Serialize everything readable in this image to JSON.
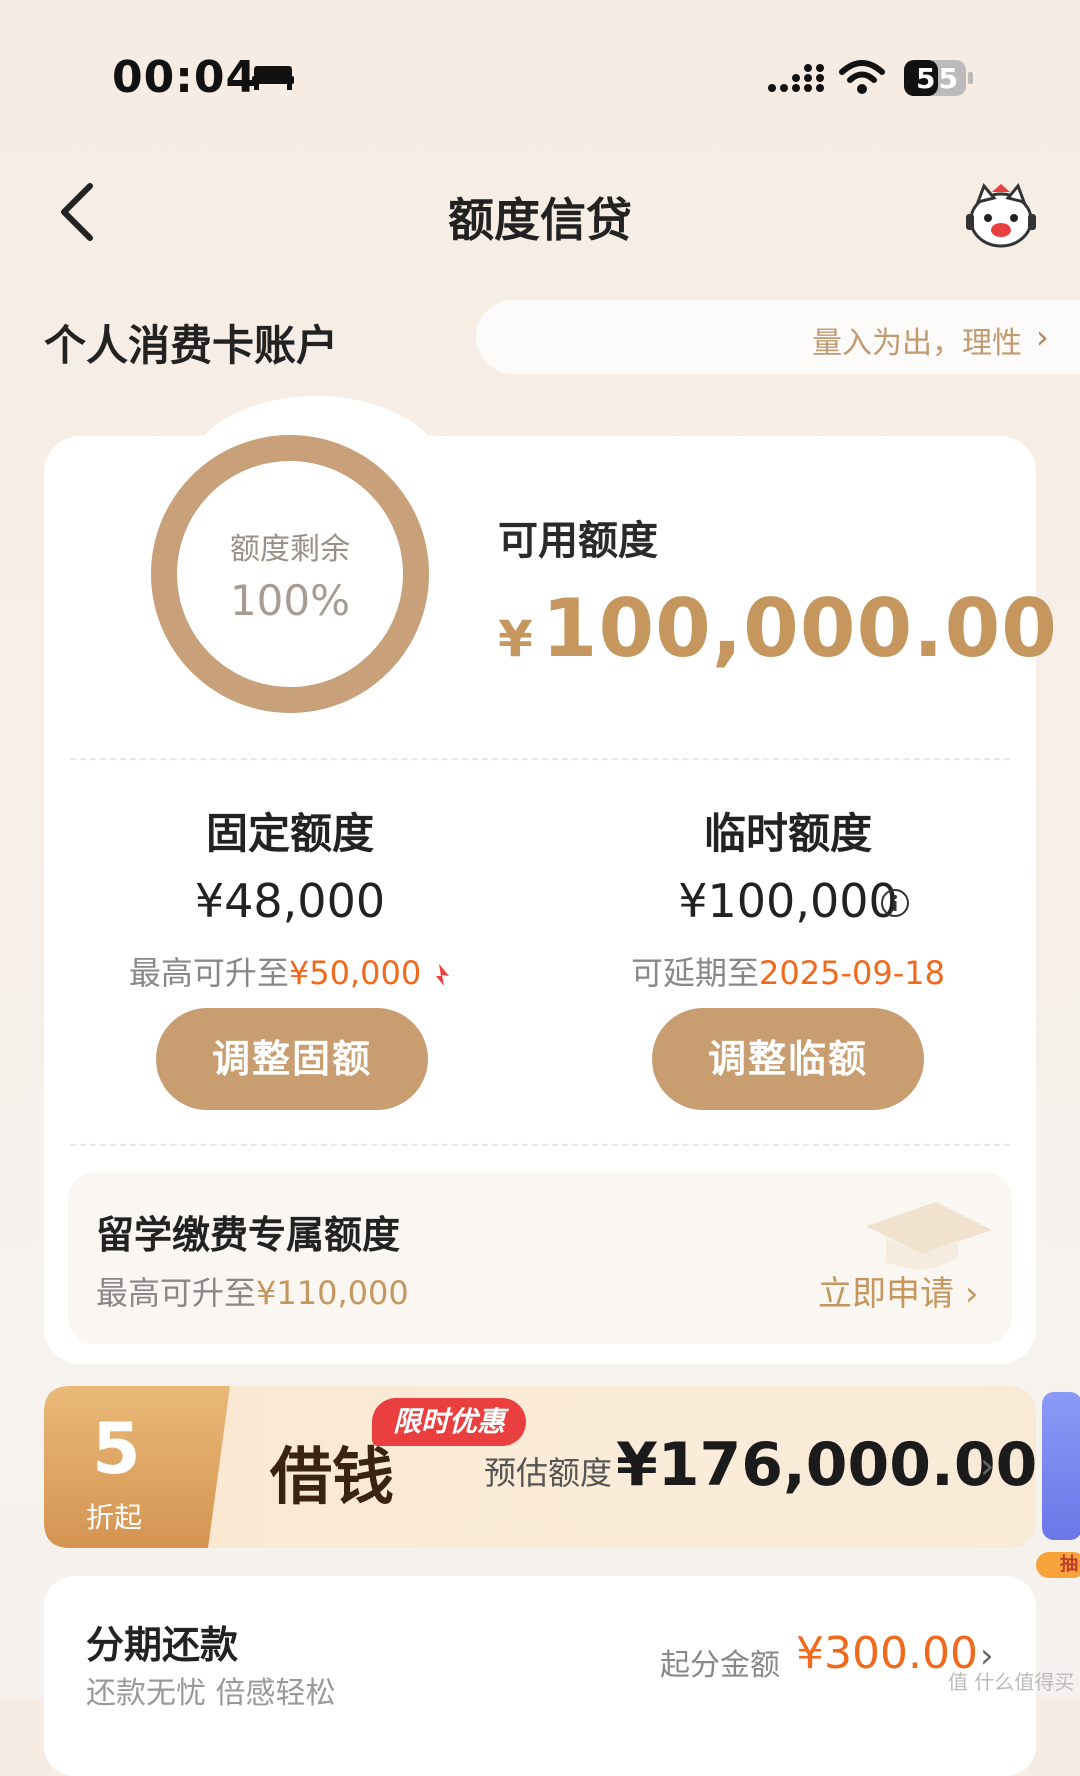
{
  "status_bar": {
    "time": "00:04",
    "battery": "55"
  },
  "nav": {
    "title": "额度信贷"
  },
  "account": {
    "title": "个人消费卡账户",
    "slogan": "量入为出，理性"
  },
  "quota": {
    "ring_label": "额度剩余",
    "ring_value": "100%",
    "ring_fraction": 1.0,
    "available_label": "可用额度",
    "available_currency": "¥",
    "available_amount": "100,000.00"
  },
  "fixed": {
    "title": "固定额度",
    "amount": "¥48,000",
    "sub_prefix": "最高可升至",
    "sub_value": "¥50,000",
    "button": "调整固额"
  },
  "temp": {
    "title": "临时额度",
    "amount": "¥100,000",
    "sub_prefix": "可延期至",
    "sub_value": "2025-09-18",
    "button": "调整临额"
  },
  "abroad": {
    "title": "留学缴费专属额度",
    "sub_prefix": "最高可升至",
    "sub_value": "¥110,000",
    "link": "立即申请"
  },
  "borrow": {
    "discount_num": "5",
    "discount_label": "折起",
    "label": "借钱",
    "badge": "限时优惠",
    "est_label": "预估额度",
    "est_amount": "¥176,000.00"
  },
  "side_tag": "抽",
  "installment": {
    "title": "分期还款",
    "sub": "还款无忧 倍感轻松",
    "min_label": "起分金额",
    "min_value": "¥300.00"
  },
  "watermark": "值 什么值得买",
  "colors": {
    "accent": "#c89e70",
    "highlight": "#f06a1e",
    "promo": "#ea3f3f"
  }
}
